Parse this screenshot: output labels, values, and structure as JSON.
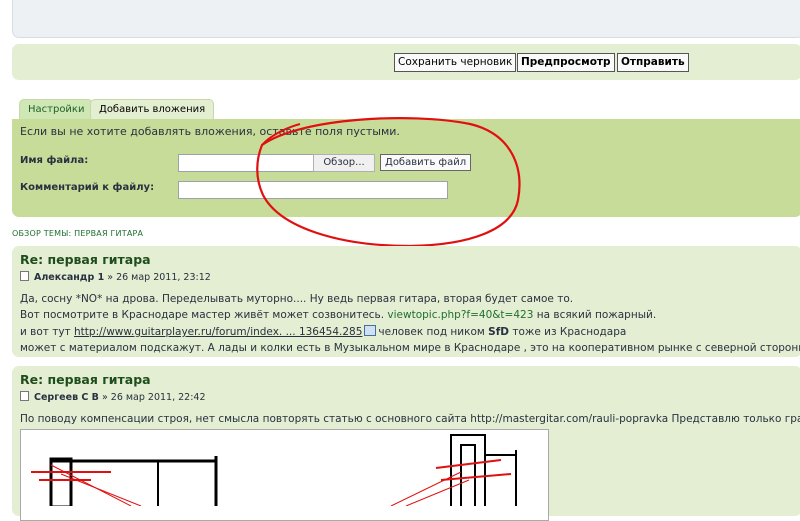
{
  "buttons": {
    "save_draft": "Сохранить черновик",
    "preview": "Предпросмотр",
    "submit": "Отправить"
  },
  "tabs": {
    "settings": "Настройки",
    "attachments": "Добавить вложения"
  },
  "attach": {
    "note": "Если вы не хотите добавлять вложения, оставьте поля пустыми.",
    "filename_label": "Имя файла:",
    "browse": "Обзор...",
    "add_file": "Добавить файл",
    "comment_label": "Комментарий к файлу:"
  },
  "overview": "ОБЗОР ТЕМЫ: ПЕРВАЯ ГИТАРА",
  "posts": [
    {
      "title": "Re: первая гитара",
      "author": "Александр 1",
      "date": "» 26 мар 2011, 23:12",
      "line1": "Да, сосну *NO* на дрова. Переделывать муторно.... Ну ведь первая гитара, вторая будет самое то.",
      "line2_pre": "Вот посмотрите в Краснодаре мастер живёт может созвонитесь.",
      "line2_link": "viewtopic.php?f=40&t=423",
      "line2_post": "на всякий пожарный.",
      "line3_pre": "и вот тут",
      "line3_link": "http://www.guitarplayer.ru/forum/index. ... 136454.285",
      "line3_post": "человек под ником",
      "line3_nick": "SfD",
      "line3_end": "тоже из Краснодара",
      "line4": "может с материалом подскажут. А лады и колки есть в Музыкальном мире в Краснодаре , это на кооперативном рынке с северной стороны."
    },
    {
      "title": "Re: первая гитара",
      "author": "Сергеев С В",
      "date": "» 26 мар 2011, 22:42",
      "line1": "По поводу компенсации строя, нет смысла повторять статью с основного сайта http://mastergitar.com/rauli-popravka Представлю только графи"
    }
  ],
  "colors": {
    "panel": "#c8dc9a",
    "post_bg": "#e4eed2",
    "link": "#1f6f30",
    "annotation": "#e01010"
  }
}
